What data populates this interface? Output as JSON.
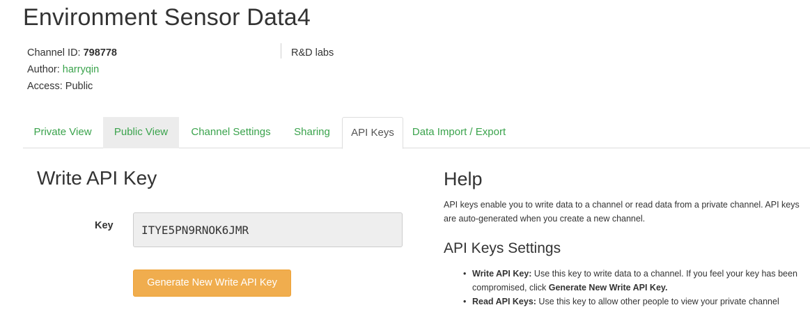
{
  "page": {
    "title": "Environment Sensor Data4"
  },
  "channel": {
    "id_label": "Channel ID:",
    "id_value": "798778",
    "author_label": "Author:",
    "author_value": "harryqin",
    "access_label": "Access:",
    "access_value": "Public",
    "org": "R&D labs"
  },
  "tabs": [
    {
      "label": "Private View"
    },
    {
      "label": "Public View"
    },
    {
      "label": "Channel Settings"
    },
    {
      "label": "Sharing"
    },
    {
      "label": "API Keys"
    },
    {
      "label": "Data Import / Export"
    }
  ],
  "write_key": {
    "section_title": "Write API Key",
    "key_label": "Key",
    "key_value": "ITYE5PN9RNOK6JMR",
    "generate_button": "Generate New Write API Key"
  },
  "help": {
    "title": "Help",
    "intro": "API keys enable you to write data to a channel or read data from a private channel. API keys are auto-generated when you create a new channel.",
    "settings_title": "API Keys Settings",
    "items": [
      {
        "term": "Write API Key:",
        "text_before": " Use this key to write data to a channel. If you feel your key has been compromised, click ",
        "emphasis": "Generate New Write API Key.",
        "text_after": ""
      },
      {
        "term": "Read API Keys:",
        "text_before": " Use this key to allow other people to view your private channel",
        "emphasis": "",
        "text_after": ""
      }
    ]
  },
  "colors": {
    "link_green": "#3aa34c",
    "warning_orange": "#f0ad4e"
  }
}
